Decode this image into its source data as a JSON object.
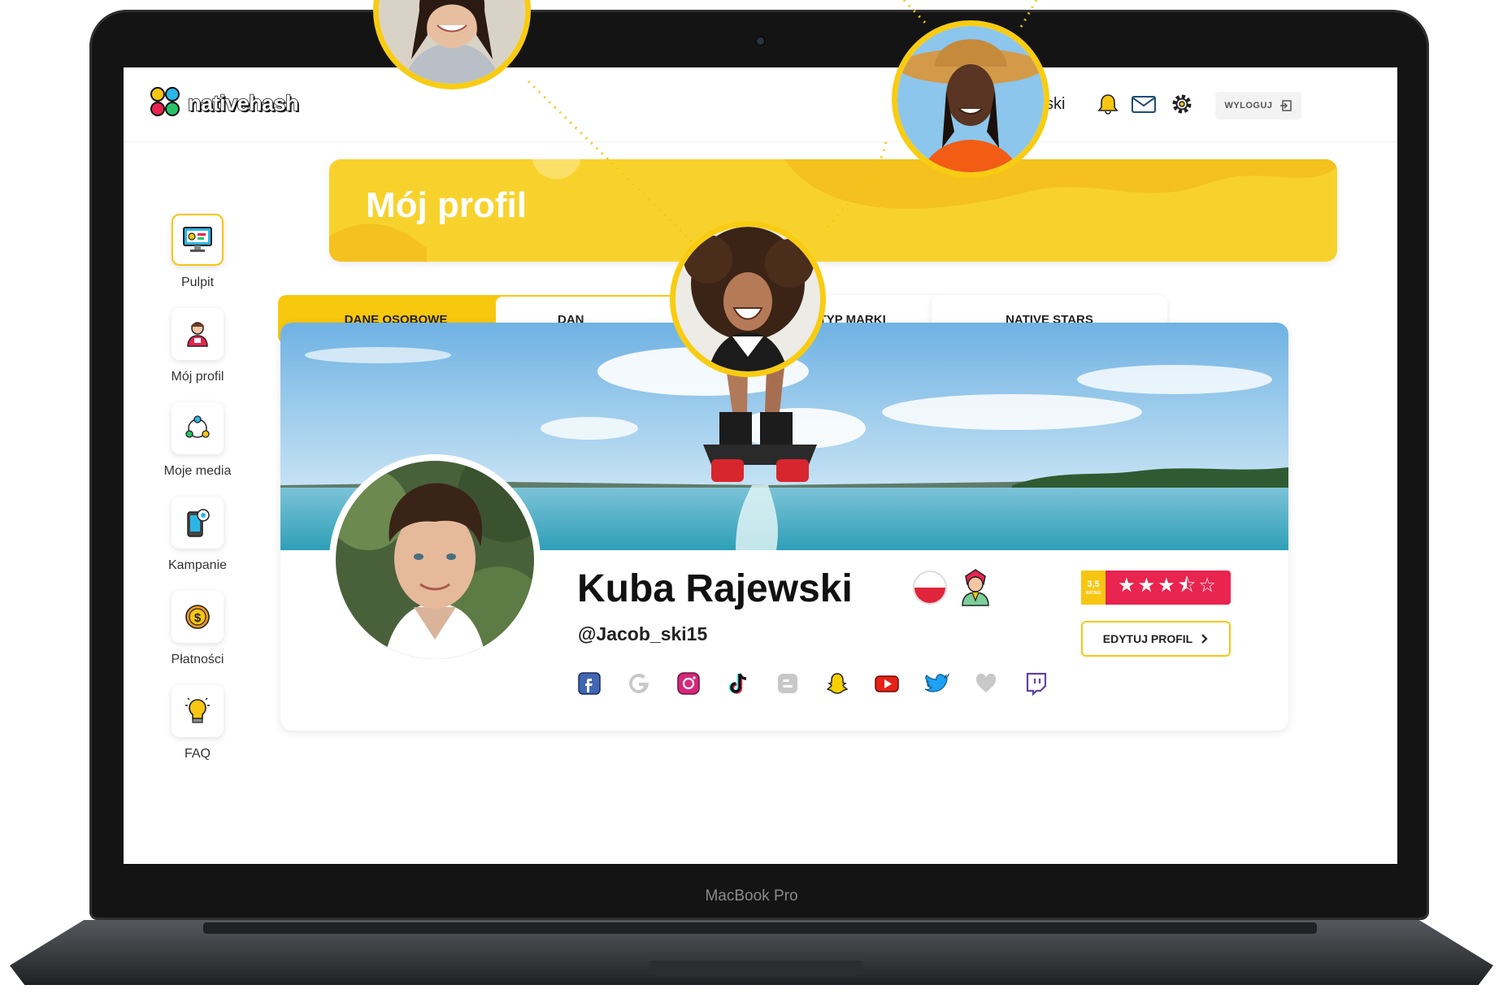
{
  "device": {
    "chin_label": "MacBook Pro"
  },
  "app": {
    "logo_text": "nativehash",
    "user_name_partial": "ski",
    "logout_label": "WYLOGUJ",
    "top_icons": [
      "bell-icon",
      "mail-icon",
      "gear-icon",
      "logout-icon"
    ]
  },
  "sidebar": {
    "items": [
      {
        "label": "Pulpit",
        "icon": "dashboard-monitor-icon",
        "active": true
      },
      {
        "label": "Mój profil",
        "icon": "user-profile-icon",
        "active": false
      },
      {
        "label": "Moje media",
        "icon": "media-network-icon",
        "active": false
      },
      {
        "label": "Kampanie",
        "icon": "campaign-phone-icon",
        "active": false
      },
      {
        "label": "Płatności",
        "icon": "coin-dollar-icon",
        "active": false
      },
      {
        "label": "FAQ",
        "icon": "lightbulb-icon",
        "active": false
      }
    ]
  },
  "banner": {
    "title": "Mój profil",
    "color": "#f8d22c"
  },
  "tabs": [
    {
      "label": "DANE OSOBOWE",
      "state": "active"
    },
    {
      "label": "DAN",
      "state": "outlined"
    },
    {
      "label": "ARCHETYP MARKI",
      "state": "default"
    },
    {
      "label": "NATIVE STARS",
      "state": "default"
    }
  ],
  "profile": {
    "full_name": "Kuba Rajewski",
    "handle": "@Jacob_ski15",
    "country_flag": "poland-flag-icon",
    "archetype_icon": "hero-avatar-icon",
    "rating": {
      "value": "3,5",
      "caption": "RATING",
      "stars": 3.5,
      "max": 5,
      "stars_text": "★★★⯪☆"
    },
    "edit_button_label": "EDYTUJ PROFIL",
    "socials": [
      {
        "name": "facebook",
        "icon": "facebook-icon",
        "color": "#3b5998",
        "connected": true
      },
      {
        "name": "google",
        "icon": "google-icon",
        "color": "#c8c8c8",
        "connected": false
      },
      {
        "name": "instagram",
        "icon": "instagram-icon",
        "color": "#c13584",
        "connected": true
      },
      {
        "name": "tiktok",
        "icon": "tiktok-icon",
        "color": "#111111",
        "connected": true
      },
      {
        "name": "blogger",
        "icon": "blogger-icon",
        "color": "#c8c8c8",
        "connected": false
      },
      {
        "name": "snapchat",
        "icon": "snapchat-icon",
        "color": "#f7d000",
        "connected": true
      },
      {
        "name": "youtube",
        "icon": "youtube-icon",
        "color": "#e62117",
        "connected": true
      },
      {
        "name": "twitter",
        "icon": "twitter-icon",
        "color": "#1da1f2",
        "connected": true
      },
      {
        "name": "likes",
        "icon": "heart-icon",
        "color": "#c8c8c8",
        "connected": false
      },
      {
        "name": "twitch",
        "icon": "twitch-icon",
        "color": "#6441a5",
        "connected": true
      }
    ]
  },
  "colors": {
    "accent": "#f8c80f",
    "rating_red": "#e8244f"
  }
}
